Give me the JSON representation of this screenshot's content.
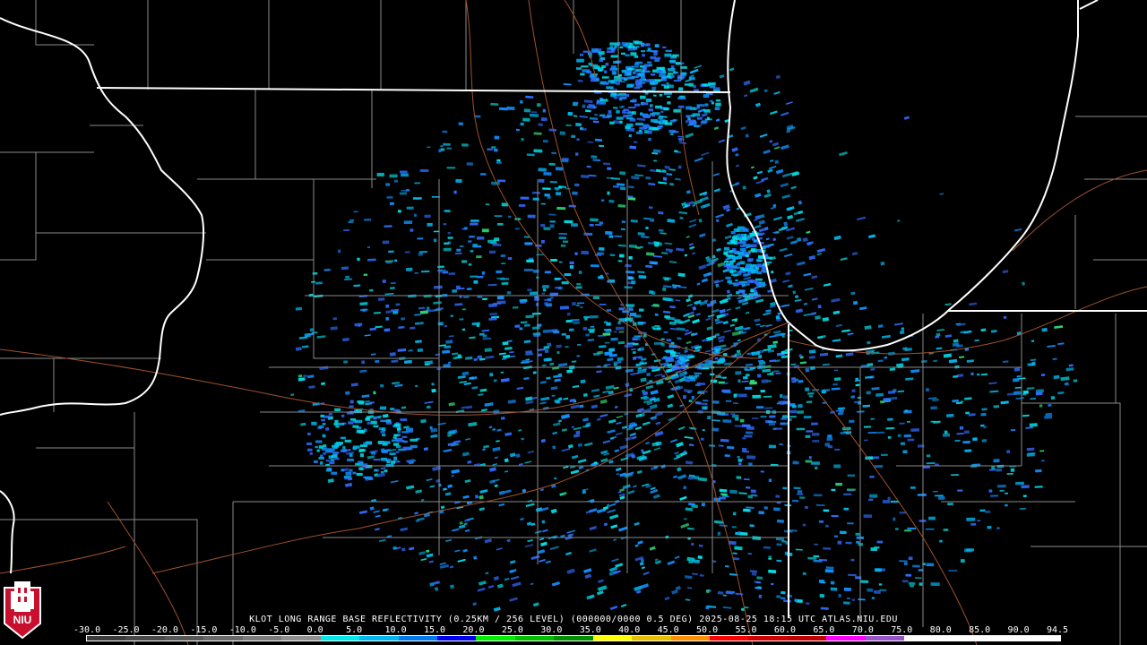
{
  "product": {
    "caption": "KLOT LONG RANGE BASE REFLECTIVITY (0.25KM / 256 LEVEL) (000000/0000 0.5 DEG) 2025-08-25 18:15 UTC  ATLAS.NIU.EDU"
  },
  "logo": {
    "text": "NIU",
    "color": "#c8102e"
  },
  "colors": {
    "background": "#000000",
    "state_borders": "#ffffff",
    "county_lines": "#8a8a8a",
    "highways": "#a0522d"
  },
  "scale": {
    "labels": [
      "-30.0",
      "-25.0",
      "-20.0",
      "-15.0",
      "-10.0",
      "-5.0",
      "0.0",
      "5.0",
      "10.0",
      "15.0",
      "20.0",
      "25.0",
      "30.0",
      "35.0",
      "40.0",
      "45.0",
      "50.0",
      "55.0",
      "60.0",
      "65.0",
      "70.0",
      "75.0",
      "80.0",
      "85.0",
      "90.0",
      "94.5"
    ],
    "colors": [
      "#3c3c3c",
      "#4a4a4a",
      "#585858",
      "#6a6a6a",
      "#7c7c7c",
      "#909090",
      "#00e8e8",
      "#00b8f0",
      "#0078f0",
      "#0000f0",
      "#00f000",
      "#00c000",
      "#009000",
      "#ffff00",
      "#e8c000",
      "#ff9000",
      "#ff0000",
      "#d00000",
      "#c00000",
      "#ff00ff",
      "#9855c8",
      "#ffffff",
      "#ffffff",
      "#ffffff",
      "#ffffff"
    ]
  },
  "radar": {
    "site": "KLOT",
    "echo_colors": [
      "#00e0e8",
      "#00b8f0",
      "#1090ff",
      "#2f6cff",
      "#00c8d8",
      "#30d878"
    ]
  }
}
